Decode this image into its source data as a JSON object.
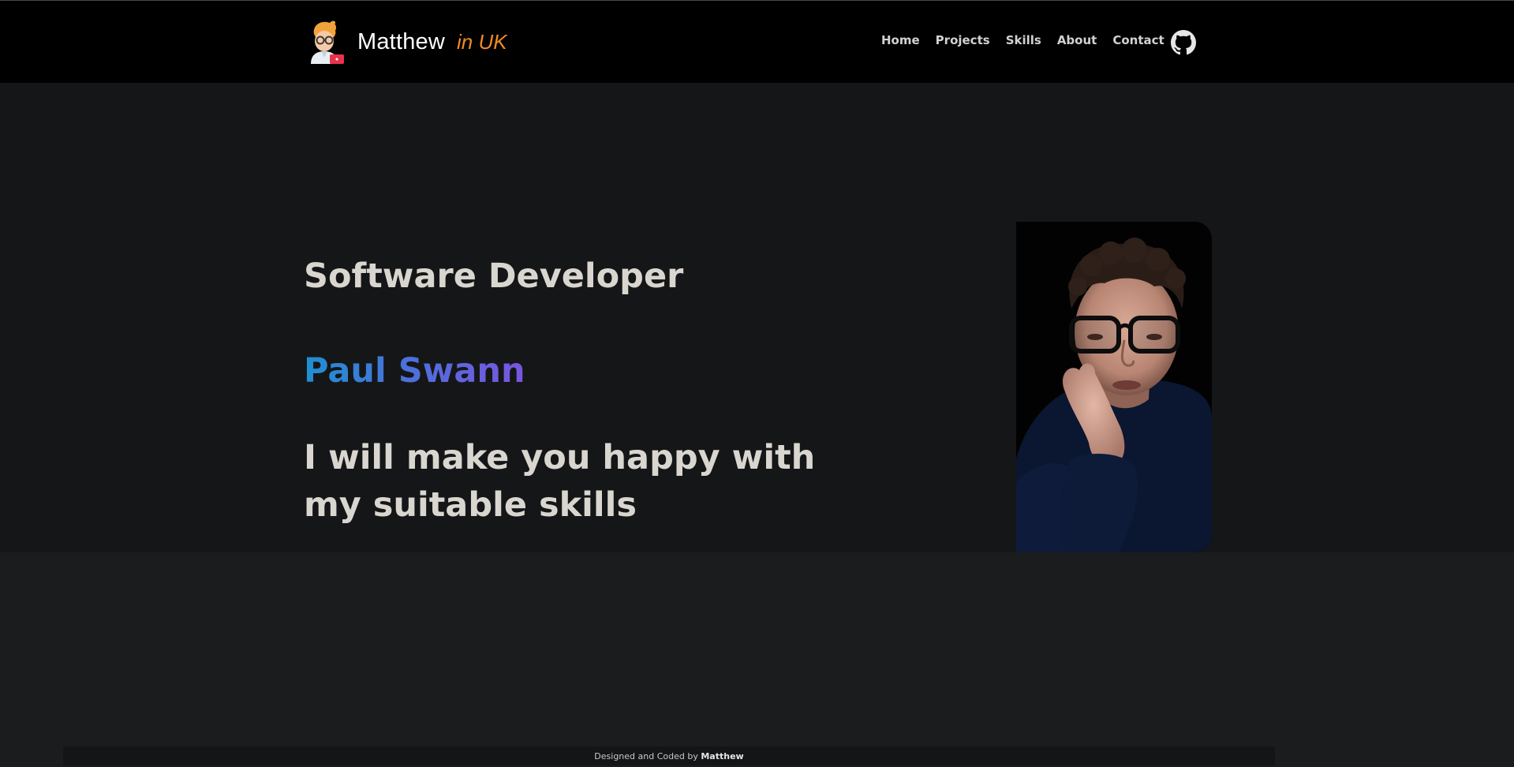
{
  "brand": {
    "name": "Matthew",
    "sub": "in UK"
  },
  "nav": {
    "items": [
      {
        "label": "Home"
      },
      {
        "label": "Projects"
      },
      {
        "label": "Skills"
      },
      {
        "label": "About"
      },
      {
        "label": "Contact"
      }
    ],
    "github_icon": "github-icon"
  },
  "hero": {
    "role": "Software Developer",
    "name": "Paul Swann",
    "tagline": "I will make you happy with my suitable skills",
    "name_gradient": [
      "#1f8fd0",
      "#7a55e0"
    ],
    "photo_icon": "profile-photo"
  },
  "footer": {
    "prefix": "Designed and Coded by",
    "author": "Matthew"
  },
  "colors": {
    "accent": "#f08a24",
    "nav_bg": "#000000",
    "hero_bg": "#151618",
    "page_bg": "#1b1c1e"
  }
}
